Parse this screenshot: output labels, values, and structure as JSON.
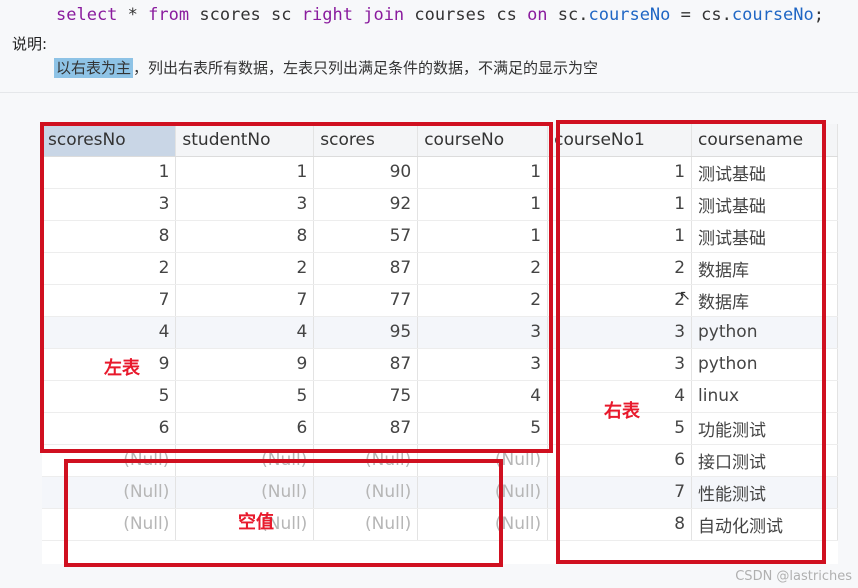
{
  "code": {
    "select": "select",
    "star": "*",
    "from": "from",
    "table1": "scores",
    "alias1": "sc",
    "right": "right",
    "join": "join",
    "table2": "courses",
    "alias2": "cs",
    "on": "on",
    "cond_left": "sc.",
    "field1": "courseNo",
    "eq": "=",
    "cond_right": "cs.",
    "field2": "courseNo",
    "semicolon": ";"
  },
  "note": {
    "label": "说明:",
    "highlight": "以右表为主",
    "rest": "，列出右表所有数据，左表只列出满足条件的数据，不满足的显示为空"
  },
  "grid": {
    "columns": [
      "scoresNo",
      "studentNo",
      "scores",
      "courseNo",
      "courseNo1",
      "coursename"
    ],
    "rows": [
      [
        "1",
        "1",
        "90",
        "1",
        "1",
        "测试基础"
      ],
      [
        "3",
        "3",
        "92",
        "1",
        "1",
        "测试基础"
      ],
      [
        "8",
        "8",
        "57",
        "1",
        "1",
        "测试基础"
      ],
      [
        "2",
        "2",
        "87",
        "2",
        "2",
        "数据库"
      ],
      [
        "7",
        "7",
        "77",
        "2",
        "2",
        "数据库"
      ],
      [
        "4",
        "4",
        "95",
        "3",
        "3",
        "python"
      ],
      [
        "9",
        "9",
        "87",
        "3",
        "3",
        "python"
      ],
      [
        "5",
        "5",
        "75",
        "4",
        "4",
        "linux"
      ],
      [
        "6",
        "6",
        "87",
        "5",
        "5",
        "功能测试"
      ],
      [
        "(Null)",
        "(Null)",
        "(Null)",
        "(Null)",
        "6",
        "接口测试"
      ],
      [
        "(Null)",
        "(Null)",
        "(Null)",
        "(Null)",
        "7",
        "性能测试"
      ],
      [
        "(Null)",
        "(Null)",
        "(Null)",
        "(Null)",
        "8",
        "自动化测试"
      ]
    ]
  },
  "annotations": {
    "left_table": "左表",
    "right_table": "右表",
    "null_values": "空值",
    "box_color": "#d01020",
    "label_color": "#e8192c"
  },
  "watermark": "CSDN @lastriches"
}
